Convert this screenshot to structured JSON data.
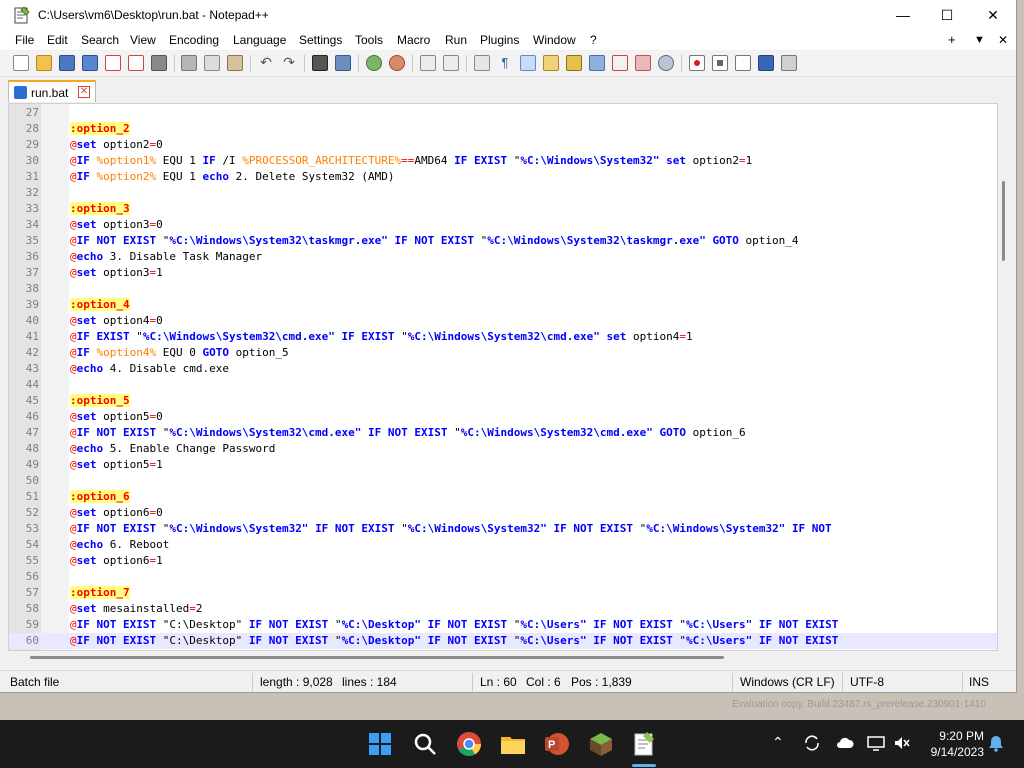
{
  "window": {
    "title": "C:\\Users\\vm6\\Desktop\\run.bat - Notepad++"
  },
  "menu": [
    "File",
    "Edit",
    "Search",
    "View",
    "Encoding",
    "Language",
    "Settings",
    "Tools",
    "Macro",
    "Run",
    "Plugins",
    "Window",
    "?"
  ],
  "menu_right": {
    "plus": "+",
    "down": "▼",
    "close": "✕"
  },
  "tab": {
    "label": "run.bat"
  },
  "editor": {
    "lines": [
      {
        "n": "27",
        "tokens": []
      },
      {
        "n": "28",
        "tokens": [
          {
            "t": ":option_2",
            "c": "label"
          }
        ]
      },
      {
        "n": "29",
        "tokens": [
          {
            "t": "@",
            "c": "at"
          },
          {
            "t": "set",
            "c": "kw"
          },
          {
            "t": " option2",
            "c": "txt"
          },
          {
            "t": "=",
            "c": "op"
          },
          {
            "t": "0",
            "c": "txt"
          }
        ]
      },
      {
        "n": "30",
        "tokens": [
          {
            "t": "@",
            "c": "at"
          },
          {
            "t": "IF",
            "c": "kw"
          },
          {
            "t": " ",
            "c": "txt"
          },
          {
            "t": "%option1%",
            "c": "var"
          },
          {
            "t": " EQU 1 ",
            "c": "txt"
          },
          {
            "t": "IF",
            "c": "kw"
          },
          {
            "t": " /I ",
            "c": "txt"
          },
          {
            "t": "%PROCESSOR_ARCHITECTURE%",
            "c": "var"
          },
          {
            "t": "==",
            "c": "op"
          },
          {
            "t": "AMD64 ",
            "c": "txt"
          },
          {
            "t": "IF EXIST",
            "c": "kw"
          },
          {
            "t": " \"",
            "c": "txt"
          },
          {
            "t": "%C:\\Windows\\System32\"",
            "c": "kw"
          },
          {
            "t": " ",
            "c": "txt"
          },
          {
            "t": "set",
            "c": "kw"
          },
          {
            "t": " option2",
            "c": "txt"
          },
          {
            "t": "=",
            "c": "op"
          },
          {
            "t": "1",
            "c": "txt"
          }
        ]
      },
      {
        "n": "31",
        "tokens": [
          {
            "t": "@",
            "c": "at"
          },
          {
            "t": "IF",
            "c": "kw"
          },
          {
            "t": " ",
            "c": "txt"
          },
          {
            "t": "%option2%",
            "c": "var"
          },
          {
            "t": " EQU 1 ",
            "c": "txt"
          },
          {
            "t": "echo",
            "c": "kw"
          },
          {
            "t": " 2. Delete System32 (AMD)",
            "c": "txt"
          }
        ]
      },
      {
        "n": "32",
        "tokens": []
      },
      {
        "n": "33",
        "tokens": [
          {
            "t": ":option_3",
            "c": "label"
          }
        ]
      },
      {
        "n": "34",
        "tokens": [
          {
            "t": "@",
            "c": "at"
          },
          {
            "t": "set",
            "c": "kw"
          },
          {
            "t": " option3",
            "c": "txt"
          },
          {
            "t": "=",
            "c": "op"
          },
          {
            "t": "0",
            "c": "txt"
          }
        ]
      },
      {
        "n": "35",
        "tokens": [
          {
            "t": "@",
            "c": "at"
          },
          {
            "t": "IF NOT EXIST",
            "c": "kw"
          },
          {
            "t": " \"",
            "c": "txt"
          },
          {
            "t": "%C:\\Windows\\System32\\taskmgr.exe\"",
            "c": "kw"
          },
          {
            "t": " ",
            "c": "txt"
          },
          {
            "t": "IF NOT EXIST",
            "c": "kw"
          },
          {
            "t": " \"",
            "c": "txt"
          },
          {
            "t": "%C:\\Windows\\System32\\taskmgr.exe\"",
            "c": "kw"
          },
          {
            "t": " ",
            "c": "txt"
          },
          {
            "t": "GOTO",
            "c": "kw"
          },
          {
            "t": " option_4",
            "c": "txt"
          }
        ]
      },
      {
        "n": "36",
        "tokens": [
          {
            "t": "@",
            "c": "at"
          },
          {
            "t": "echo",
            "c": "kw"
          },
          {
            "t": " 3. Disable Task Manager",
            "c": "txt"
          }
        ]
      },
      {
        "n": "37",
        "tokens": [
          {
            "t": "@",
            "c": "at"
          },
          {
            "t": "set",
            "c": "kw"
          },
          {
            "t": " option3",
            "c": "txt"
          },
          {
            "t": "=",
            "c": "op"
          },
          {
            "t": "1",
            "c": "txt"
          }
        ]
      },
      {
        "n": "38",
        "tokens": []
      },
      {
        "n": "39",
        "tokens": [
          {
            "t": ":option_4",
            "c": "label"
          }
        ]
      },
      {
        "n": "40",
        "tokens": [
          {
            "t": "@",
            "c": "at"
          },
          {
            "t": "set",
            "c": "kw"
          },
          {
            "t": " option4",
            "c": "txt"
          },
          {
            "t": "=",
            "c": "op"
          },
          {
            "t": "0",
            "c": "txt"
          }
        ]
      },
      {
        "n": "41",
        "tokens": [
          {
            "t": "@",
            "c": "at"
          },
          {
            "t": "IF EXIST",
            "c": "kw"
          },
          {
            "t": " \"",
            "c": "txt"
          },
          {
            "t": "%C:\\Windows\\System32\\cmd.exe\"",
            "c": "kw"
          },
          {
            "t": " ",
            "c": "txt"
          },
          {
            "t": "IF EXIST",
            "c": "kw"
          },
          {
            "t": " \"",
            "c": "txt"
          },
          {
            "t": "%C:\\Windows\\System32\\cmd.exe\"",
            "c": "kw"
          },
          {
            "t": " ",
            "c": "txt"
          },
          {
            "t": "set",
            "c": "kw"
          },
          {
            "t": " option4",
            "c": "txt"
          },
          {
            "t": "=",
            "c": "op"
          },
          {
            "t": "1",
            "c": "txt"
          }
        ]
      },
      {
        "n": "42",
        "tokens": [
          {
            "t": "@",
            "c": "at"
          },
          {
            "t": "IF",
            "c": "kw"
          },
          {
            "t": " ",
            "c": "txt"
          },
          {
            "t": "%option4%",
            "c": "var"
          },
          {
            "t": " EQU 0 ",
            "c": "txt"
          },
          {
            "t": "GOTO",
            "c": "kw"
          },
          {
            "t": " option_5",
            "c": "txt"
          }
        ]
      },
      {
        "n": "43",
        "tokens": [
          {
            "t": "@",
            "c": "at"
          },
          {
            "t": "echo",
            "c": "kw"
          },
          {
            "t": " 4. Disable cmd.exe",
            "c": "txt"
          }
        ]
      },
      {
        "n": "44",
        "tokens": []
      },
      {
        "n": "45",
        "tokens": [
          {
            "t": ":option_5",
            "c": "label"
          }
        ]
      },
      {
        "n": "46",
        "tokens": [
          {
            "t": "@",
            "c": "at"
          },
          {
            "t": "set",
            "c": "kw"
          },
          {
            "t": " option5",
            "c": "txt"
          },
          {
            "t": "=",
            "c": "op"
          },
          {
            "t": "0",
            "c": "txt"
          }
        ]
      },
      {
        "n": "47",
        "tokens": [
          {
            "t": "@",
            "c": "at"
          },
          {
            "t": "IF NOT EXIST",
            "c": "kw"
          },
          {
            "t": " \"",
            "c": "txt"
          },
          {
            "t": "%C:\\Windows\\System32\\cmd.exe\"",
            "c": "kw"
          },
          {
            "t": " ",
            "c": "txt"
          },
          {
            "t": "IF NOT EXIST",
            "c": "kw"
          },
          {
            "t": " \"",
            "c": "txt"
          },
          {
            "t": "%C:\\Windows\\System32\\cmd.exe\"",
            "c": "kw"
          },
          {
            "t": " ",
            "c": "txt"
          },
          {
            "t": "GOTO",
            "c": "kw"
          },
          {
            "t": " option_6",
            "c": "txt"
          }
        ]
      },
      {
        "n": "48",
        "tokens": [
          {
            "t": "@",
            "c": "at"
          },
          {
            "t": "echo",
            "c": "kw"
          },
          {
            "t": " 5. Enable Change Password",
            "c": "txt"
          }
        ]
      },
      {
        "n": "49",
        "tokens": [
          {
            "t": "@",
            "c": "at"
          },
          {
            "t": "set",
            "c": "kw"
          },
          {
            "t": " option5",
            "c": "txt"
          },
          {
            "t": "=",
            "c": "op"
          },
          {
            "t": "1",
            "c": "txt"
          }
        ]
      },
      {
        "n": "50",
        "tokens": []
      },
      {
        "n": "51",
        "tokens": [
          {
            "t": ":option_6",
            "c": "label"
          }
        ]
      },
      {
        "n": "52",
        "tokens": [
          {
            "t": "@",
            "c": "at"
          },
          {
            "t": "set",
            "c": "kw"
          },
          {
            "t": " option6",
            "c": "txt"
          },
          {
            "t": "=",
            "c": "op"
          },
          {
            "t": "0",
            "c": "txt"
          }
        ]
      },
      {
        "n": "53",
        "tokens": [
          {
            "t": "@",
            "c": "at"
          },
          {
            "t": "IF NOT EXIST",
            "c": "kw"
          },
          {
            "t": " \"",
            "c": "txt"
          },
          {
            "t": "%C:\\Windows\\System32\"",
            "c": "kw"
          },
          {
            "t": " ",
            "c": "txt"
          },
          {
            "t": "IF NOT EXIST",
            "c": "kw"
          },
          {
            "t": " \"",
            "c": "txt"
          },
          {
            "t": "%C:\\Windows\\System32\"",
            "c": "kw"
          },
          {
            "t": " ",
            "c": "txt"
          },
          {
            "t": "IF NOT EXIST",
            "c": "kw"
          },
          {
            "t": " \"",
            "c": "txt"
          },
          {
            "t": "%C:\\Windows\\System32\"",
            "c": "kw"
          },
          {
            "t": " ",
            "c": "txt"
          },
          {
            "t": "IF NOT",
            "c": "kw"
          }
        ]
      },
      {
        "n": "54",
        "tokens": [
          {
            "t": "@",
            "c": "at"
          },
          {
            "t": "echo",
            "c": "kw"
          },
          {
            "t": " 6. Reboot",
            "c": "txt"
          }
        ]
      },
      {
        "n": "55",
        "tokens": [
          {
            "t": "@",
            "c": "at"
          },
          {
            "t": "set",
            "c": "kw"
          },
          {
            "t": " option6",
            "c": "txt"
          },
          {
            "t": "=",
            "c": "op"
          },
          {
            "t": "1",
            "c": "txt"
          }
        ]
      },
      {
        "n": "56",
        "tokens": []
      },
      {
        "n": "57",
        "tokens": [
          {
            "t": ":option_7",
            "c": "label"
          }
        ]
      },
      {
        "n": "58",
        "tokens": [
          {
            "t": "@",
            "c": "at"
          },
          {
            "t": "set",
            "c": "kw"
          },
          {
            "t": " mesainstalled",
            "c": "txt"
          },
          {
            "t": "=",
            "c": "op"
          },
          {
            "t": "2",
            "c": "txt"
          }
        ]
      },
      {
        "n": "59",
        "tokens": [
          {
            "t": "@",
            "c": "at"
          },
          {
            "t": "IF NOT EXIST",
            "c": "kw"
          },
          {
            "t": " \"C:\\Desktop\" ",
            "c": "txt"
          },
          {
            "t": "IF NOT EXIST",
            "c": "kw"
          },
          {
            "t": " \"",
            "c": "txt"
          },
          {
            "t": "%C:\\Desktop\"",
            "c": "kw"
          },
          {
            "t": " ",
            "c": "txt"
          },
          {
            "t": "IF NOT EXIST",
            "c": "kw"
          },
          {
            "t": " \"",
            "c": "txt"
          },
          {
            "t": "%C:\\Users\"",
            "c": "kw"
          },
          {
            "t": " ",
            "c": "txt"
          },
          {
            "t": "IF NOT EXIST",
            "c": "kw"
          },
          {
            "t": " \"",
            "c": "txt"
          },
          {
            "t": "%C:\\Users\"",
            "c": "kw"
          },
          {
            "t": " ",
            "c": "txt"
          },
          {
            "t": "IF NOT EXIST",
            "c": "kw"
          }
        ]
      },
      {
        "n": "60",
        "tokens": [
          {
            "t": "@",
            "c": "at"
          },
          {
            "t": "IF NOT EXIST",
            "c": "kw"
          },
          {
            "t": " \"C:\\Desktop\" ",
            "c": "txt"
          },
          {
            "t": "IF NOT EXIST",
            "c": "kw"
          },
          {
            "t": " \"",
            "c": "txt"
          },
          {
            "t": "%C:\\Desktop\"",
            "c": "kw"
          },
          {
            "t": " ",
            "c": "txt"
          },
          {
            "t": "IF NOT EXIST",
            "c": "kw"
          },
          {
            "t": " \"",
            "c": "txt"
          },
          {
            "t": "%C:\\Users\"",
            "c": "kw"
          },
          {
            "t": " ",
            "c": "txt"
          },
          {
            "t": "IF NOT EXIST",
            "c": "kw"
          },
          {
            "t": " \"",
            "c": "txt"
          },
          {
            "t": "%C:\\Users\"",
            "c": "kw"
          },
          {
            "t": " ",
            "c": "txt"
          },
          {
            "t": "IF NOT EXIST",
            "c": "kw"
          }
        ],
        "current": true
      }
    ]
  },
  "statusbar": {
    "file_type": "Batch file",
    "length": "length : 9,028",
    "lines": "lines : 184",
    "ln": "Ln : 60",
    "col": "Col : 6",
    "pos": "Pos : 1,839",
    "eol": "Windows (CR LF)",
    "encoding": "UTF-8",
    "mode": "INS"
  },
  "taskbar": {
    "apps": [
      "windows-start",
      "search",
      "chrome",
      "file-explorer",
      "powerpoint",
      "minecraft",
      "notepad-plus-plus"
    ],
    "time": "9:20 PM",
    "date": "9/14/2023"
  },
  "watermark": "Evaluation copy. Build 23487.rs_prerelease.230901-1410"
}
